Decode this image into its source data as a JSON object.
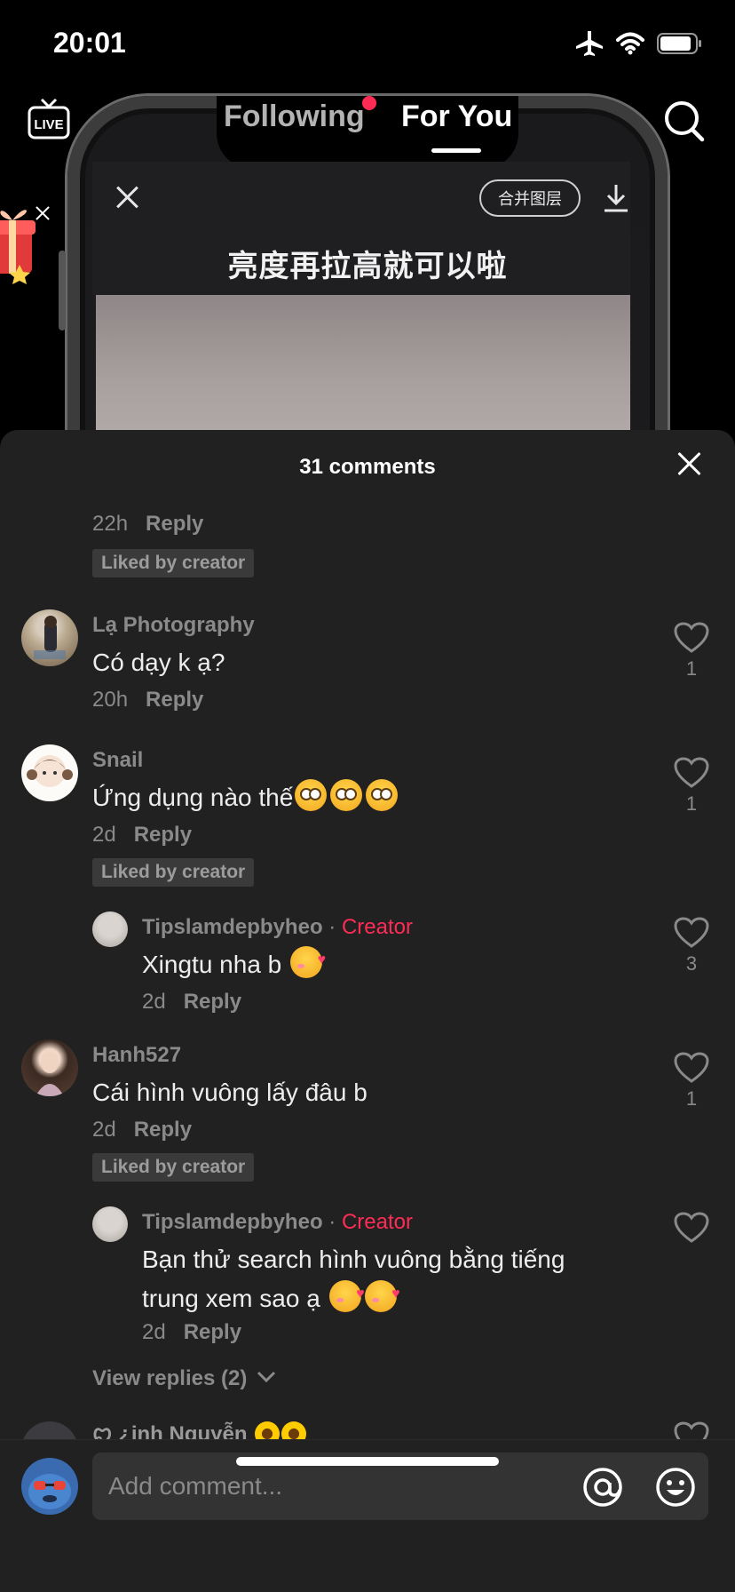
{
  "status_bar": {
    "time": "20:01"
  },
  "top_nav": {
    "live_label": "LIVE",
    "tabs": [
      {
        "label": "Following",
        "active": false,
        "has_dot": true
      },
      {
        "label": "For You",
        "active": true
      }
    ]
  },
  "video": {
    "overlay_pill": "合并图层",
    "overlay_title": "亮度再拉高就可以啦"
  },
  "comments_sheet": {
    "title": "31 comments",
    "comments": [
      {
        "time": "22h",
        "reply_label": "Reply",
        "liked_by_creator": "Liked by creator"
      },
      {
        "username": "Lạ Photography",
        "text": "Có dạy k ạ?",
        "time": "20h",
        "reply_label": "Reply",
        "likes": "1"
      },
      {
        "username": "Snail",
        "text": "Ứng dụng nào thế",
        "emojis": [
          "flushed-face",
          "flushed-face",
          "flushed-face"
        ],
        "time": "2d",
        "reply_label": "Reply",
        "likes": "1",
        "liked_by_creator": "Liked by creator",
        "replies": [
          {
            "username": "Tipslamdepbyheo",
            "separator": "·",
            "badge": "Creator",
            "text": "Xingtu nha b",
            "emojis": [
              "smiling-face-with-hearts"
            ],
            "time": "2d",
            "reply_label": "Reply",
            "likes": "3"
          }
        ]
      },
      {
        "username": "Hanh527",
        "text": "Cái hình vuông lấy đâu b",
        "time": "2d",
        "reply_label": "Reply",
        "likes": "1",
        "liked_by_creator": "Liked by creator",
        "replies": [
          {
            "username": "Tipslamdepbyheo",
            "separator": "·",
            "badge": "Creator",
            "text_line1": "Bạn thử search hình vuông bằng tiếng",
            "text_line2": "trung xem sao ạ",
            "emojis": [
              "smiling-face-with-hearts",
              "smiling-face-with-hearts"
            ],
            "time": "2d",
            "reply_label": "Reply",
            "likes": ""
          }
        ],
        "view_replies": "View replies (2)"
      },
      {
        "username_partial": "ꨄ ¿inh Nguyễn"
      }
    ]
  },
  "composer": {
    "placeholder": "Add comment..."
  },
  "colors": {
    "sheet_bg": "#212121",
    "creator_red": "#fe2c55",
    "muted_text": "#8a8a8a"
  }
}
